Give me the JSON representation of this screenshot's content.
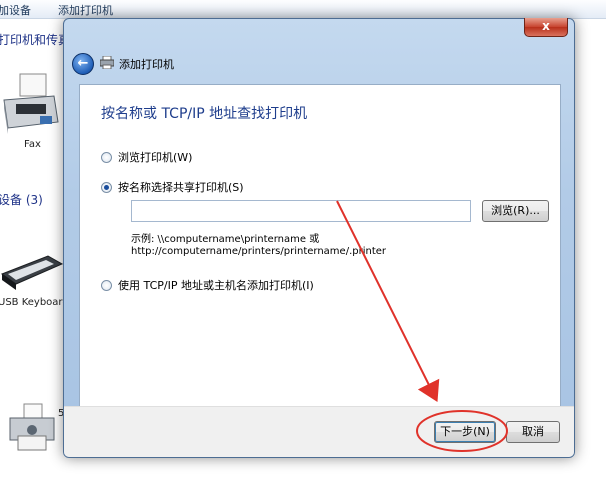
{
  "background": {
    "toolbar": {
      "item_add_device": "加设备",
      "item_add_printer": "添加打印机"
    },
    "heading_printers": "打印机和传真",
    "heading_devices": "设备 (3)",
    "devices": [
      {
        "label": "Fax",
        "icon": "fax-icon"
      },
      {
        "label": "USB Keyboard",
        "icon": "keyboard-icon"
      },
      {
        "label": "5",
        "icon": "printer-icon"
      }
    ]
  },
  "dialog": {
    "close_label": "x",
    "back_icon": "back-arrow-icon",
    "title": "添加打印机",
    "heading": "按名称或 TCP/IP 地址查找打印机",
    "options": [
      {
        "label": "浏览打印机(W)",
        "checked": false
      },
      {
        "label": "按名称选择共享打印机(S)",
        "checked": true
      },
      {
        "label": "使用 TCP/IP 地址或主机名添加打印机(I)",
        "checked": false
      }
    ],
    "share_input_value": "",
    "browse_label": "浏览(R)...",
    "example_line1": "示例: \\\\computername\\printername 或",
    "example_line2": "http://computername/printers/printername/.printer",
    "next_label": "下一步(N)",
    "cancel_label": "取消"
  },
  "colors": {
    "annotation": "#e0322a",
    "heading": "#1e3d8c"
  }
}
